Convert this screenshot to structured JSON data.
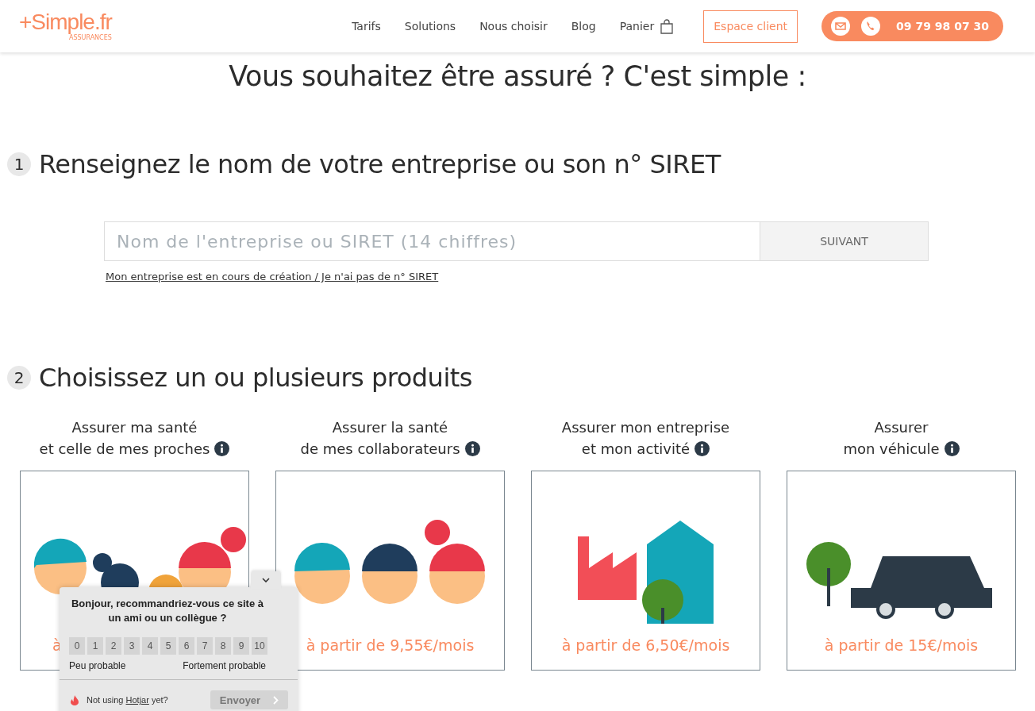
{
  "header": {
    "logo": "+Simple.fr",
    "logo_sub": "ASSURANCES",
    "nav": [
      "Tarifs",
      "Solutions",
      "Nous choisir",
      "Blog",
      "Panier"
    ],
    "client_button": "Espace client",
    "phone": "09 79 98 07 30"
  },
  "headline": "Vous souhaitez être assuré ? C'est simple :",
  "step1": {
    "number": "1",
    "title": "Renseignez le nom de votre entreprise ou son n° SIRET",
    "placeholder": "Nom de l'entreprise ou SIRET (14 chiffres)",
    "button": "SUIVANT",
    "link": "Mon entreprise est en cours de création / Je n'ai pas de n° SIRET"
  },
  "step2": {
    "number": "2",
    "title": "Choisissez un ou plusieurs produits",
    "products": [
      {
        "kind": "family",
        "title_line1": "Assurer ma santé",
        "title_line2": "et celle de mes proches",
        "price": "à"
      },
      {
        "kind": "team",
        "title_line1": "Assurer la santé",
        "title_line2": "de mes collaborateurs",
        "price": "à partir de 9,55€/mois"
      },
      {
        "kind": "business",
        "title_line1": "Assurer mon entreprise",
        "title_line2": "et mon activité",
        "price": "à partir de 6,50€/mois"
      },
      {
        "kind": "vehicle",
        "title_line1": "Assurer",
        "title_line2": "mon véhicule",
        "price": "à partir de 15€/mois"
      }
    ]
  },
  "survey": {
    "question": "Bonjour, recommandriez-vous ce site à un ami ou un collègue ?",
    "scores": [
      "0",
      "1",
      "2",
      "3",
      "4",
      "5",
      "6",
      "7",
      "8",
      "9",
      "10"
    ],
    "low_label": "Peu probable",
    "high_label": "Fortement probable",
    "footer_prefix": "Not using",
    "footer_link": "Hotjar",
    "footer_suffix": "yet?",
    "send_button": "Envoyer",
    "send_disabled": true
  }
}
